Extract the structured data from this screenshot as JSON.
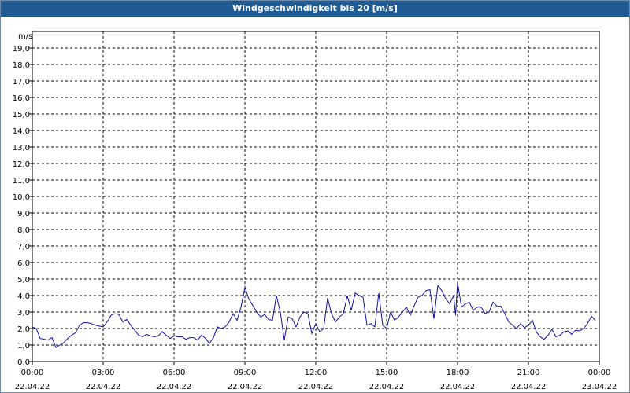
{
  "window": {
    "title": "Windgeschwindigkeit bis 20 [m/s]"
  },
  "colors": {
    "titlebar": "#1f5a92",
    "series": "#1010a0",
    "grid": "#000000"
  },
  "chart_data": {
    "type": "line",
    "title": "Windgeschwindigkeit bis 20 [m/s]",
    "ylabel": "m/s",
    "xlabel": "",
    "ylim": [
      0,
      20
    ],
    "xlim": [
      "22.04.22 00:00",
      "23.04.22 00:00"
    ],
    "grid": true,
    "y_ticks": [
      "0,0",
      "1,0",
      "2,0",
      "3,0",
      "4,0",
      "5,0",
      "6,0",
      "7,0",
      "8,0",
      "9,0",
      "10,0",
      "11,0",
      "12,0",
      "13,0",
      "14,0",
      "15,0",
      "16,0",
      "17,0",
      "18,0",
      "19,0"
    ],
    "x_ticks": [
      {
        "time": "00:00",
        "date": "22.04.22"
      },
      {
        "time": "03:00",
        "date": "22.04.22"
      },
      {
        "time": "06:00",
        "date": "22.04.22"
      },
      {
        "time": "09:00",
        "date": "22.04.22"
      },
      {
        "time": "12:00",
        "date": "22.04.22"
      },
      {
        "time": "15:00",
        "date": "22.04.22"
      },
      {
        "time": "18:00",
        "date": "22.04.22"
      },
      {
        "time": "21:00",
        "date": "22.04.22"
      },
      {
        "time": "00:00",
        "date": "23.04.22"
      }
    ],
    "series": [
      {
        "points": [
          [
            "00:00",
            2.1
          ],
          [
            "00:10",
            2.0
          ],
          [
            "00:20",
            1.4
          ],
          [
            "00:30",
            1.35
          ],
          [
            "00:40",
            1.3
          ],
          [
            "00:50",
            1.45
          ],
          [
            "01:00",
            0.85
          ],
          [
            "01:10",
            1.0
          ],
          [
            "01:20",
            1.15
          ],
          [
            "01:30",
            1.4
          ],
          [
            "01:40",
            1.6
          ],
          [
            "01:50",
            1.75
          ],
          [
            "02:00",
            2.2
          ],
          [
            "02:10",
            2.35
          ],
          [
            "02:20",
            2.35
          ],
          [
            "02:30",
            2.3
          ],
          [
            "02:40",
            2.2
          ],
          [
            "02:50",
            2.15
          ],
          [
            "03:00",
            2.1
          ],
          [
            "03:10",
            2.4
          ],
          [
            "03:20",
            2.8
          ],
          [
            "03:30",
            2.9
          ],
          [
            "03:40",
            2.85
          ],
          [
            "03:50",
            2.4
          ],
          [
            "04:00",
            2.55
          ],
          [
            "04:10",
            2.2
          ],
          [
            "04:20",
            1.9
          ],
          [
            "04:30",
            1.6
          ],
          [
            "04:40",
            1.5
          ],
          [
            "04:50",
            1.65
          ],
          [
            "05:00",
            1.55
          ],
          [
            "05:10",
            1.5
          ],
          [
            "05:20",
            1.55
          ],
          [
            "05:30",
            1.8
          ],
          [
            "05:40",
            1.6
          ],
          [
            "05:50",
            1.4
          ],
          [
            "06:00",
            1.55
          ],
          [
            "06:10",
            1.5
          ],
          [
            "06:20",
            1.5
          ],
          [
            "06:30",
            1.35
          ],
          [
            "06:40",
            1.45
          ],
          [
            "06:50",
            1.45
          ],
          [
            "07:00",
            1.3
          ],
          [
            "07:10",
            1.6
          ],
          [
            "07:20",
            1.4
          ],
          [
            "07:30",
            1.1
          ],
          [
            "07:40",
            1.45
          ],
          [
            "07:50",
            2.1
          ],
          [
            "08:00",
            2.0
          ],
          [
            "08:10",
            2.1
          ],
          [
            "08:20",
            2.4
          ],
          [
            "08:30",
            2.9
          ],
          [
            "08:40",
            2.5
          ],
          [
            "08:50",
            3.3
          ],
          [
            "09:00",
            4.5
          ],
          [
            "09:10",
            3.8
          ],
          [
            "09:20",
            3.4
          ],
          [
            "09:30",
            3.0
          ],
          [
            "09:40",
            2.7
          ],
          [
            "09:50",
            2.85
          ],
          [
            "10:00",
            2.55
          ],
          [
            "10:10",
            2.5
          ],
          [
            "10:20",
            4.0
          ],
          [
            "10:30",
            3.0
          ],
          [
            "10:40",
            1.3
          ],
          [
            "10:50",
            2.7
          ],
          [
            "11:00",
            2.6
          ],
          [
            "11:10",
            2.1
          ],
          [
            "11:20",
            2.7
          ],
          [
            "11:30",
            3.0
          ],
          [
            "11:40",
            2.9
          ],
          [
            "11:50",
            1.7
          ],
          [
            "12:00",
            2.3
          ],
          [
            "12:10",
            1.8
          ],
          [
            "12:20",
            2.0
          ],
          [
            "12:30",
            3.85
          ],
          [
            "12:40",
            2.9
          ],
          [
            "12:50",
            2.4
          ],
          [
            "13:00",
            2.7
          ],
          [
            "13:10",
            2.9
          ],
          [
            "13:20",
            4.0
          ],
          [
            "13:30",
            3.1
          ],
          [
            "13:40",
            4.15
          ],
          [
            "13:50",
            4.0
          ],
          [
            "14:00",
            3.9
          ],
          [
            "14:10",
            2.2
          ],
          [
            "14:20",
            2.3
          ],
          [
            "14:30",
            2.1
          ],
          [
            "14:40",
            4.15
          ],
          [
            "14:50",
            2.2
          ],
          [
            "15:00",
            2.0
          ],
          [
            "15:10",
            3.0
          ],
          [
            "15:20",
            2.5
          ],
          [
            "15:30",
            2.7
          ],
          [
            "15:40",
            3.0
          ],
          [
            "15:50",
            3.3
          ],
          [
            "16:00",
            2.8
          ],
          [
            "16:10",
            3.4
          ],
          [
            "16:20",
            3.9
          ],
          [
            "16:30",
            4.0
          ],
          [
            "16:40",
            4.3
          ],
          [
            "16:50",
            4.35
          ],
          [
            "17:00",
            2.6
          ],
          [
            "17:10",
            4.6
          ],
          [
            "17:20",
            4.3
          ],
          [
            "17:30",
            3.8
          ],
          [
            "17:40",
            3.5
          ],
          [
            "17:50",
            4.0
          ],
          [
            "17:55",
            2.8
          ],
          [
            "18:00",
            4.8
          ],
          [
            "18:10",
            3.3
          ],
          [
            "18:20",
            3.5
          ],
          [
            "18:30",
            3.6
          ],
          [
            "18:40",
            3.1
          ],
          [
            "18:50",
            3.3
          ],
          [
            "19:00",
            3.3
          ],
          [
            "19:10",
            2.9
          ],
          [
            "19:20",
            3.0
          ],
          [
            "19:30",
            3.6
          ],
          [
            "19:40",
            3.35
          ],
          [
            "19:50",
            3.35
          ],
          [
            "20:00",
            2.9
          ],
          [
            "20:10",
            2.4
          ],
          [
            "20:20",
            2.2
          ],
          [
            "20:30",
            2.0
          ],
          [
            "20:40",
            2.3
          ],
          [
            "20:50",
            2.05
          ],
          [
            "21:00",
            2.2
          ],
          [
            "21:10",
            2.5
          ],
          [
            "21:20",
            1.8
          ],
          [
            "21:30",
            1.5
          ],
          [
            "21:40",
            1.35
          ],
          [
            "21:50",
            1.6
          ],
          [
            "22:00",
            1.95
          ],
          [
            "22:10",
            1.5
          ],
          [
            "22:20",
            1.6
          ],
          [
            "22:30",
            1.8
          ],
          [
            "22:40",
            1.85
          ],
          [
            "22:50",
            1.65
          ],
          [
            "23:00",
            1.9
          ],
          [
            "23:10",
            1.85
          ],
          [
            "23:20",
            2.0
          ],
          [
            "23:30",
            2.3
          ],
          [
            "23:40",
            2.75
          ],
          [
            "23:50",
            2.5
          ]
        ]
      }
    ]
  }
}
